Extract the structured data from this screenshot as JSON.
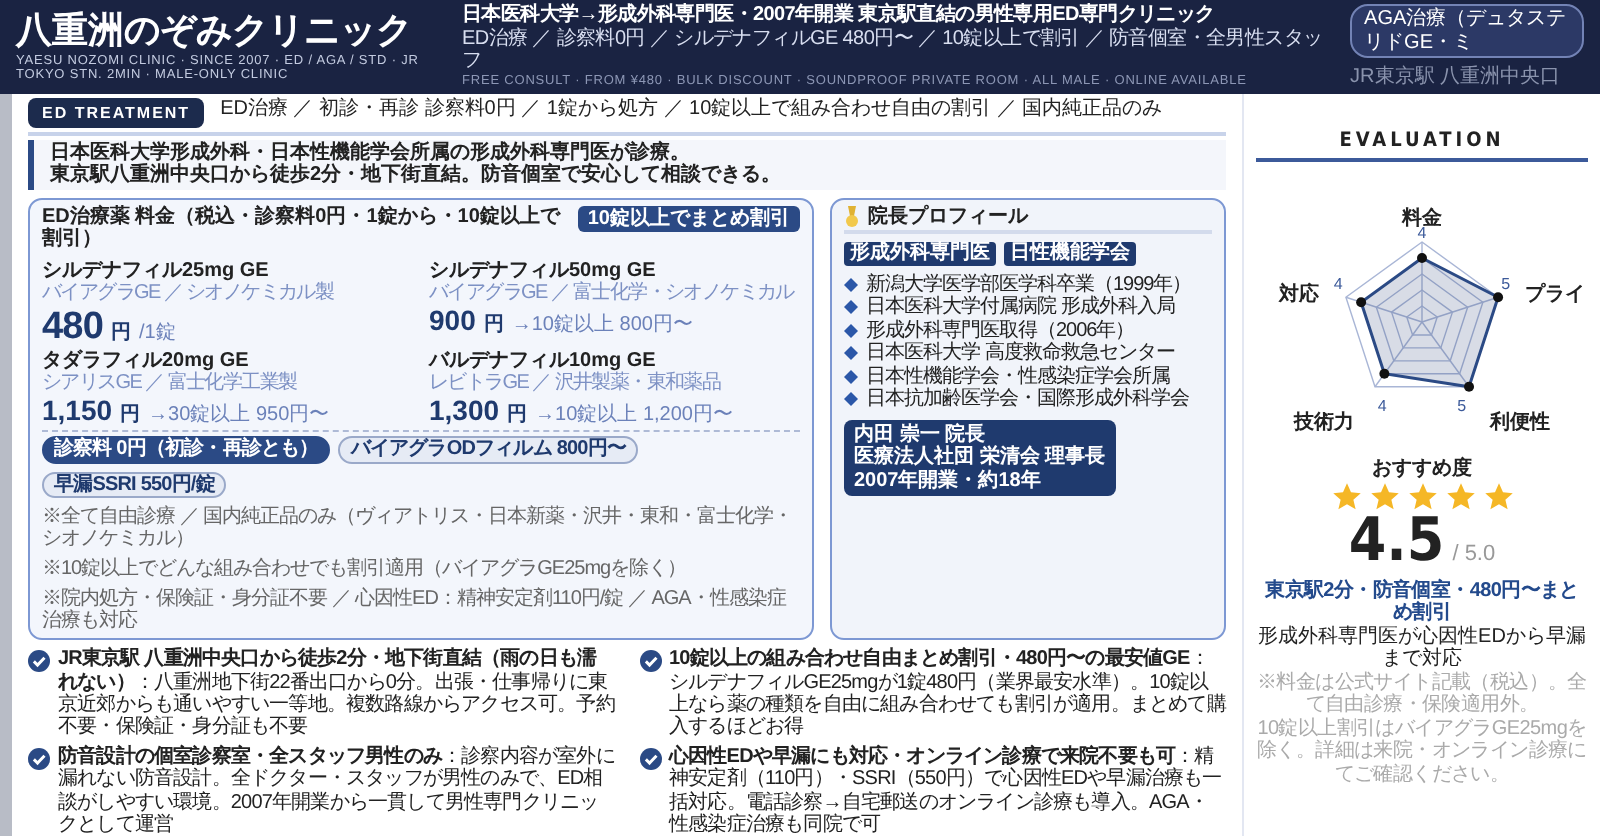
{
  "header": {
    "title": "八重洲のぞみクリニック",
    "subtitle": "YAESU NOZOMI CLINIC · SINCE 2007 · ED / AGA / STD · JR TOKYO STN. 2MIN · MALE-ONLY CLINIC",
    "headline": "日本医科大学→形成外科専門医・2007年開業 東京駅直結の男性専用ED専門クリニック",
    "summary": "ED治療 ／ 診察料0円 ／ シルデナフィルGE 480円〜 ／ 10錠以上で割引 ／ 防音個室・全男性スタッフ",
    "tagline": "FREE CONSULT · FROM ¥480 · BULK DISCOUNT · SOUNDPROOF PRIVATE ROOM · ALL MALE · ONLINE AVAILABLE",
    "tag": "AGA治療（デュタステリドGE・ミ",
    "location": "JR東京駅 八重洲中央口"
  },
  "treatment": {
    "badge": "ED TREATMENT",
    "text": "ED治療 ／ 初診・再診 診察料0円 ／ 1錠から処方 ／ 10錠以上で組み合わせ自由の割引 ／ 国内純正品のみ"
  },
  "callout": [
    "**日本医科大学形成外科・日本性機能学会所属の形成外科専門医**が診療。",
    "東京駅八重洲中央口から**徒歩2分・地下街直結**。防音個室で安心して相談できる。"
  ],
  "price_card": {
    "title": "ED治療薬 料金（税込・診察料0円・1錠から・10錠以上で割引）",
    "badge": "10錠以上でまとめ割引",
    "drugs": [
      {
        "name": "シルデナフィル25mg GE",
        "maker": "バイアグラGE ／ シオノケミカル製",
        "amount": "480",
        "unit": "円",
        "note": "/1錠",
        "featured": true
      },
      {
        "name": "シルデナフィル50mg GE",
        "maker": "バイアグラGE ／ 富士化学・シオノケミカル",
        "amount": "900",
        "unit": "円",
        "note": "→10錠以上 800円〜",
        "featured": false
      },
      {
        "name": "タダラフィル20mg GE",
        "maker": "シアリスGE ／ 富士化学工業製",
        "amount": "1,150",
        "unit": "円",
        "note": "→30錠以上 950円〜",
        "featured": false
      },
      {
        "name": "バルデナフィル10mg GE",
        "maker": "レビトラGE ／ 沢井製薬・東和薬品",
        "amount": "1,300",
        "unit": "円",
        "note": "→10錠以上 1,200円〜",
        "featured": false
      }
    ],
    "pills": [
      {
        "label": "診察料 0円（初診・再診とも）",
        "kind": "filled"
      },
      {
        "label": "バイアグラODフィルム 800円〜",
        "kind": "outline"
      },
      {
        "label": "早漏SSRI 550円/錠",
        "kind": "outline"
      }
    ],
    "notes": [
      "※全て自由診療 ／ 国内純正品のみ（ヴィアトリス・日本新薬・沢井・東和・富士化学・シオノケミカル）",
      "※10錠以上でどんな組み合わせでも割引適用（バイアグラGE25mgを除く）",
      "※院内処方・保険証・身分証不要 ／ 心因性ED：精神安定剤110円/錠 ／ AGA・性感染症治療も対応"
    ]
  },
  "profile": {
    "title": "院長プロフィール",
    "tags": [
      "形成外科専門医",
      "日性機能学会"
    ],
    "career": [
      "新潟大学医学部医学科卒業（1999年）",
      "日本医科大学付属病院 形成外科入局",
      "形成外科専門医取得（2006年）",
      "日本医科大学 高度救命救急センター",
      "日本性機能学会・性感染症学会所属",
      "日本抗加齢医学会・国際形成外科学会"
    ],
    "card": [
      "内田 崇一 院長",
      "医療法人社団 栄清会 理事長",
      "2007年開業・約18年"
    ]
  },
  "features": [
    "**JR東京駅 八重洲中央口から徒歩2分・地下街直結（雨の日も濡れない）**：八重洲地下街22番出口から0分。出張・仕事帰りに東京近郊からも通いやすい一等地。複数路線からアクセス可。予約不要・保険証・身分証も不要",
    "**防音設計の個室診察室・全スタッフ男性のみ**：診察内容が室外に漏れない防音設計。全ドクター・スタッフが男性のみで、ED相談がしやすい環境。2007年開業から一貫して男性専門クリニックとして運営",
    "**10錠以上の組み合わせ自由まとめ割引・480円〜の最安値GE**：シルデナフィルGE25mgが1錠480円（業界最安水準）。10錠以上なら薬の種類を自由に組み合わせても割引が適用。まとめて購入するほどお得",
    "**心因性EDや早漏にも対応・オンライン診療で来院不要も可**：精神安定剤（110円）・SSRI（550円）で心因性EDや早漏治療も一括対応。電話診察→自宅郵送のオンライン診療も導入。AGA・性感染症治療も同院で可"
  ],
  "evaluation": {
    "heading": "EVALUATION",
    "radar": [
      {
        "label": "料金",
        "score": "4"
      },
      {
        "label": "対応",
        "score": "4"
      },
      {
        "label": "プライ",
        "score": "5"
      },
      {
        "label": "技術力",
        "score": "4"
      },
      {
        "label": "利便性",
        "score": "5"
      }
    ],
    "recommend_label": "おすすめ度",
    "stars": 5,
    "score": "4.5",
    "max": "/ 5.0",
    "highlight": "東京駅2分・防音個室・480円〜まとめ割引",
    "summary": "形成外科専門医が心因性EDから早漏まで対応",
    "notes": [
      "※料金は公式サイト記載（税込）。全て自由診療・保険適用外。",
      "10錠以上割引はバイアグラGE25mgを除く。詳細は来院・オンライン診療にてご確認ください。"
    ]
  }
}
